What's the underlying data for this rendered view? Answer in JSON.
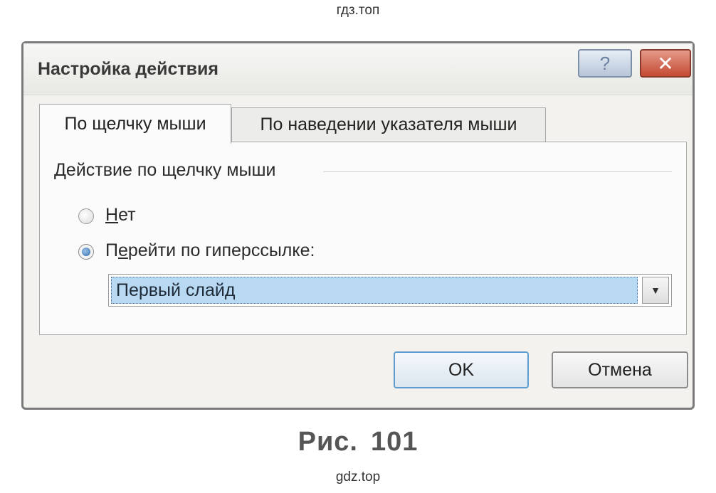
{
  "watermark_top": "гдз.топ",
  "watermark_bottom": "gdz.top",
  "caption": {
    "prefix": "Рис.",
    "number": "101"
  },
  "dialog": {
    "title": "Настройка действия",
    "help_glyph": "?",
    "close_glyph": "✕",
    "tabs": [
      {
        "label": "По щелчку мыши",
        "active": true
      },
      {
        "label": "По наведении указателя мыши",
        "active": false
      }
    ],
    "group_label": "Действие по щелчку мыши",
    "options": [
      {
        "label_accel": "Н",
        "label_rest": "ет",
        "selected": false
      },
      {
        "label_pre": "П",
        "label_accel": "е",
        "label_rest": "рейти по гиперссылке:",
        "selected": true
      }
    ],
    "hyperlink_select": {
      "value": "Первый слайд",
      "arrow_glyph": "▼"
    },
    "buttons": {
      "ok": "OK",
      "cancel": "Отмена"
    }
  }
}
